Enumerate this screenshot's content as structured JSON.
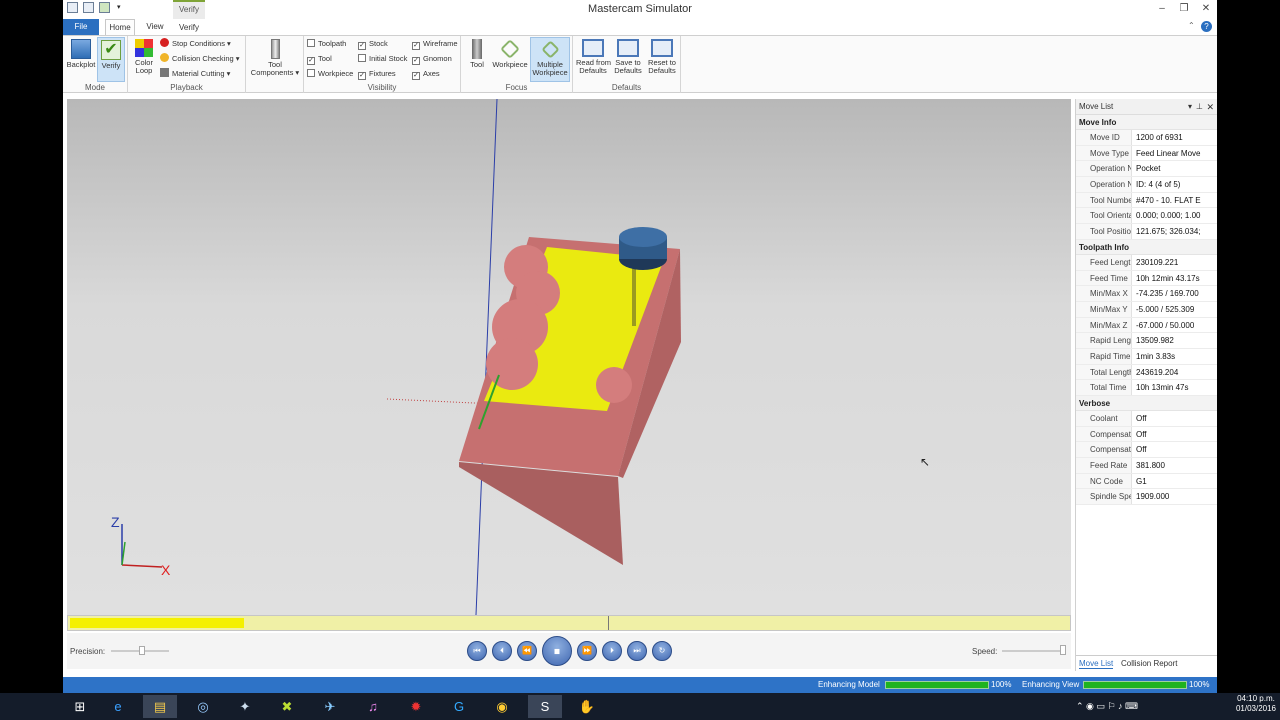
{
  "window": {
    "title": "Mastercam Simulator",
    "context_tab": "Verify"
  },
  "tabs": [
    {
      "label": "File"
    },
    {
      "label": "Home"
    },
    {
      "label": "View"
    },
    {
      "label": "Verify"
    }
  ],
  "ribbon": {
    "mode": {
      "label": "Mode",
      "backplot": "Backplot",
      "verify": "Verify"
    },
    "playback": {
      "label": "Playback",
      "color_loop": "Color\nLoop",
      "stop_conditions": "Stop Conditions",
      "collision_checking": "Collision Checking",
      "material_cutting": "Material Cutting"
    },
    "tool_components": {
      "label": "Tool\nComponents"
    },
    "visibility": {
      "label": "Visibility",
      "items": [
        {
          "label": "Toolpath",
          "checked": false
        },
        {
          "label": "Tool",
          "checked": true
        },
        {
          "label": "Workpiece",
          "checked": false
        },
        {
          "label": "Stock",
          "checked": true
        },
        {
          "label": "Initial Stock",
          "checked": false
        },
        {
          "label": "Fixtures",
          "checked": true
        },
        {
          "label": "Wireframe",
          "checked": true
        },
        {
          "label": "Gnomon",
          "checked": true
        },
        {
          "label": "Axes",
          "checked": true
        }
      ]
    },
    "focus": {
      "label": "Focus",
      "tool": "Tool",
      "workpiece": "Workpiece",
      "multiple_workpiece": "Multiple\nWorkpiece"
    },
    "defaults": {
      "label": "Defaults",
      "read": "Read from\nDefaults",
      "save": "Save to\nDefaults",
      "reset": "Reset to\nDefaults"
    }
  },
  "viewport": {
    "gnomon_z": "Z",
    "gnomon_x": "X"
  },
  "playbar": {
    "precision_label": "Precision:",
    "speed_label": "Speed:",
    "timeline_progress": 0.174
  },
  "panel": {
    "title": "Move List",
    "sections": [
      {
        "title": "Move Info",
        "rows": [
          {
            "k": "Move ID",
            "v": "1200 of 6931"
          },
          {
            "k": "Move Type",
            "v": "Feed Linear Move"
          },
          {
            "k": "Operation Na",
            "v": "Pocket"
          },
          {
            "k": "Operation Nu",
            "v": "ID: 4 (4 of 5)"
          },
          {
            "k": "Tool Number",
            "v": "#470 - 10. FLAT E"
          },
          {
            "k": "Tool Orientati",
            "v": "0.000; 0.000; 1.00"
          },
          {
            "k": "Tool Position",
            "v": "121.675; 326.034;"
          }
        ]
      },
      {
        "title": "Toolpath Info",
        "rows": [
          {
            "k": "Feed Length",
            "v": "230109.221"
          },
          {
            "k": "Feed Time",
            "v": "10h 12min 43.17s"
          },
          {
            "k": "Min/Max X",
            "v": "-74.235 / 169.700"
          },
          {
            "k": "Min/Max Y",
            "v": "-5.000 / 525.309"
          },
          {
            "k": "Min/Max Z",
            "v": "-67.000 / 50.000"
          },
          {
            "k": "Rapid Length",
            "v": "13509.982"
          },
          {
            "k": "Rapid Time",
            "v": "1min 3.83s"
          },
          {
            "k": "Total Length",
            "v": "243619.204"
          },
          {
            "k": "Total Time",
            "v": "10h 13min 47s"
          }
        ]
      },
      {
        "title": "Verbose",
        "rows": [
          {
            "k": "Coolant",
            "v": "Off"
          },
          {
            "k": "Compensation",
            "v": "Off"
          },
          {
            "k": "Compensation",
            "v": "Off"
          },
          {
            "k": "Feed Rate",
            "v": "381.800"
          },
          {
            "k": "NC Code",
            "v": "G1"
          },
          {
            "k": "Spindle Speed",
            "v": "1909.000"
          }
        ]
      }
    ],
    "tabs": [
      {
        "label": "Move List"
      },
      {
        "label": "Collision Report"
      }
    ]
  },
  "status": {
    "enhancing_model": "Enhancing Model",
    "model_pct": "100%",
    "model_progress": 1.0,
    "enhancing_view": "Enhancing View",
    "view_pct": "100%",
    "view_progress": 1.0
  },
  "taskbar": {
    "time": "04:10 p.m.",
    "date": "01/03/2016"
  }
}
